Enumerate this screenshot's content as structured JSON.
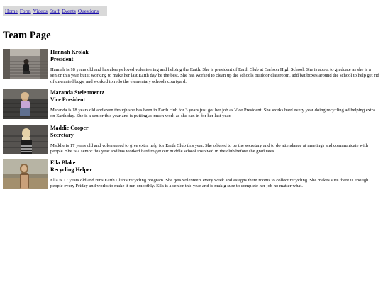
{
  "nav": {
    "items": [
      "Home",
      "Form",
      "Videos",
      "Staff",
      "Events",
      "Questions"
    ]
  },
  "page": {
    "title": "Team Page"
  },
  "members": [
    {
      "name": "Hannah Krolak",
      "role": "President",
      "bio": "Hannah is 18 years old and has always loved volenteering and helping the Earth. She is president of Earth Club at Carlson High School. She is about to graduate as she is a senior this year but it working to make her last Earth day be the best. She has worked to clean up the schools outdoor classroom, add bat boxes around the school to help get rid of unwanted bugs, and worked to redo the elementary schools courtyard."
    },
    {
      "name": "Maranda Steienmentz",
      "role": "Vice President",
      "bio": "Maranda is 18 years old and even though she has been in Earth club for 3 years just got her job as Vice President. She works hard every year doing recycling ad helping extra on Earth day. She is a senior this year and is putting as much work as she can in for her last year."
    },
    {
      "name": "Maddie Cooper",
      "role": "Secretary",
      "bio": "Maddie is 17 years old and volenteered to give extra help for Earth Club this year. She offered to be the secretary and to do attendance at meetings and communicate with people. She is a senior this year and has worked hard to get our middle school involved in the club before she graduates."
    },
    {
      "name": "Ella Blake",
      "role": "Recycling Helper",
      "bio": "Ella is 17 years old and runs Earth Club's recycling program. She gets volenteers every week and assigns them rooms to collect recycling. She makes sure there is enough people every Friday and works to make it run smoothly. Ella is a senior this year and is makig sure to complete her job no matter what."
    }
  ]
}
